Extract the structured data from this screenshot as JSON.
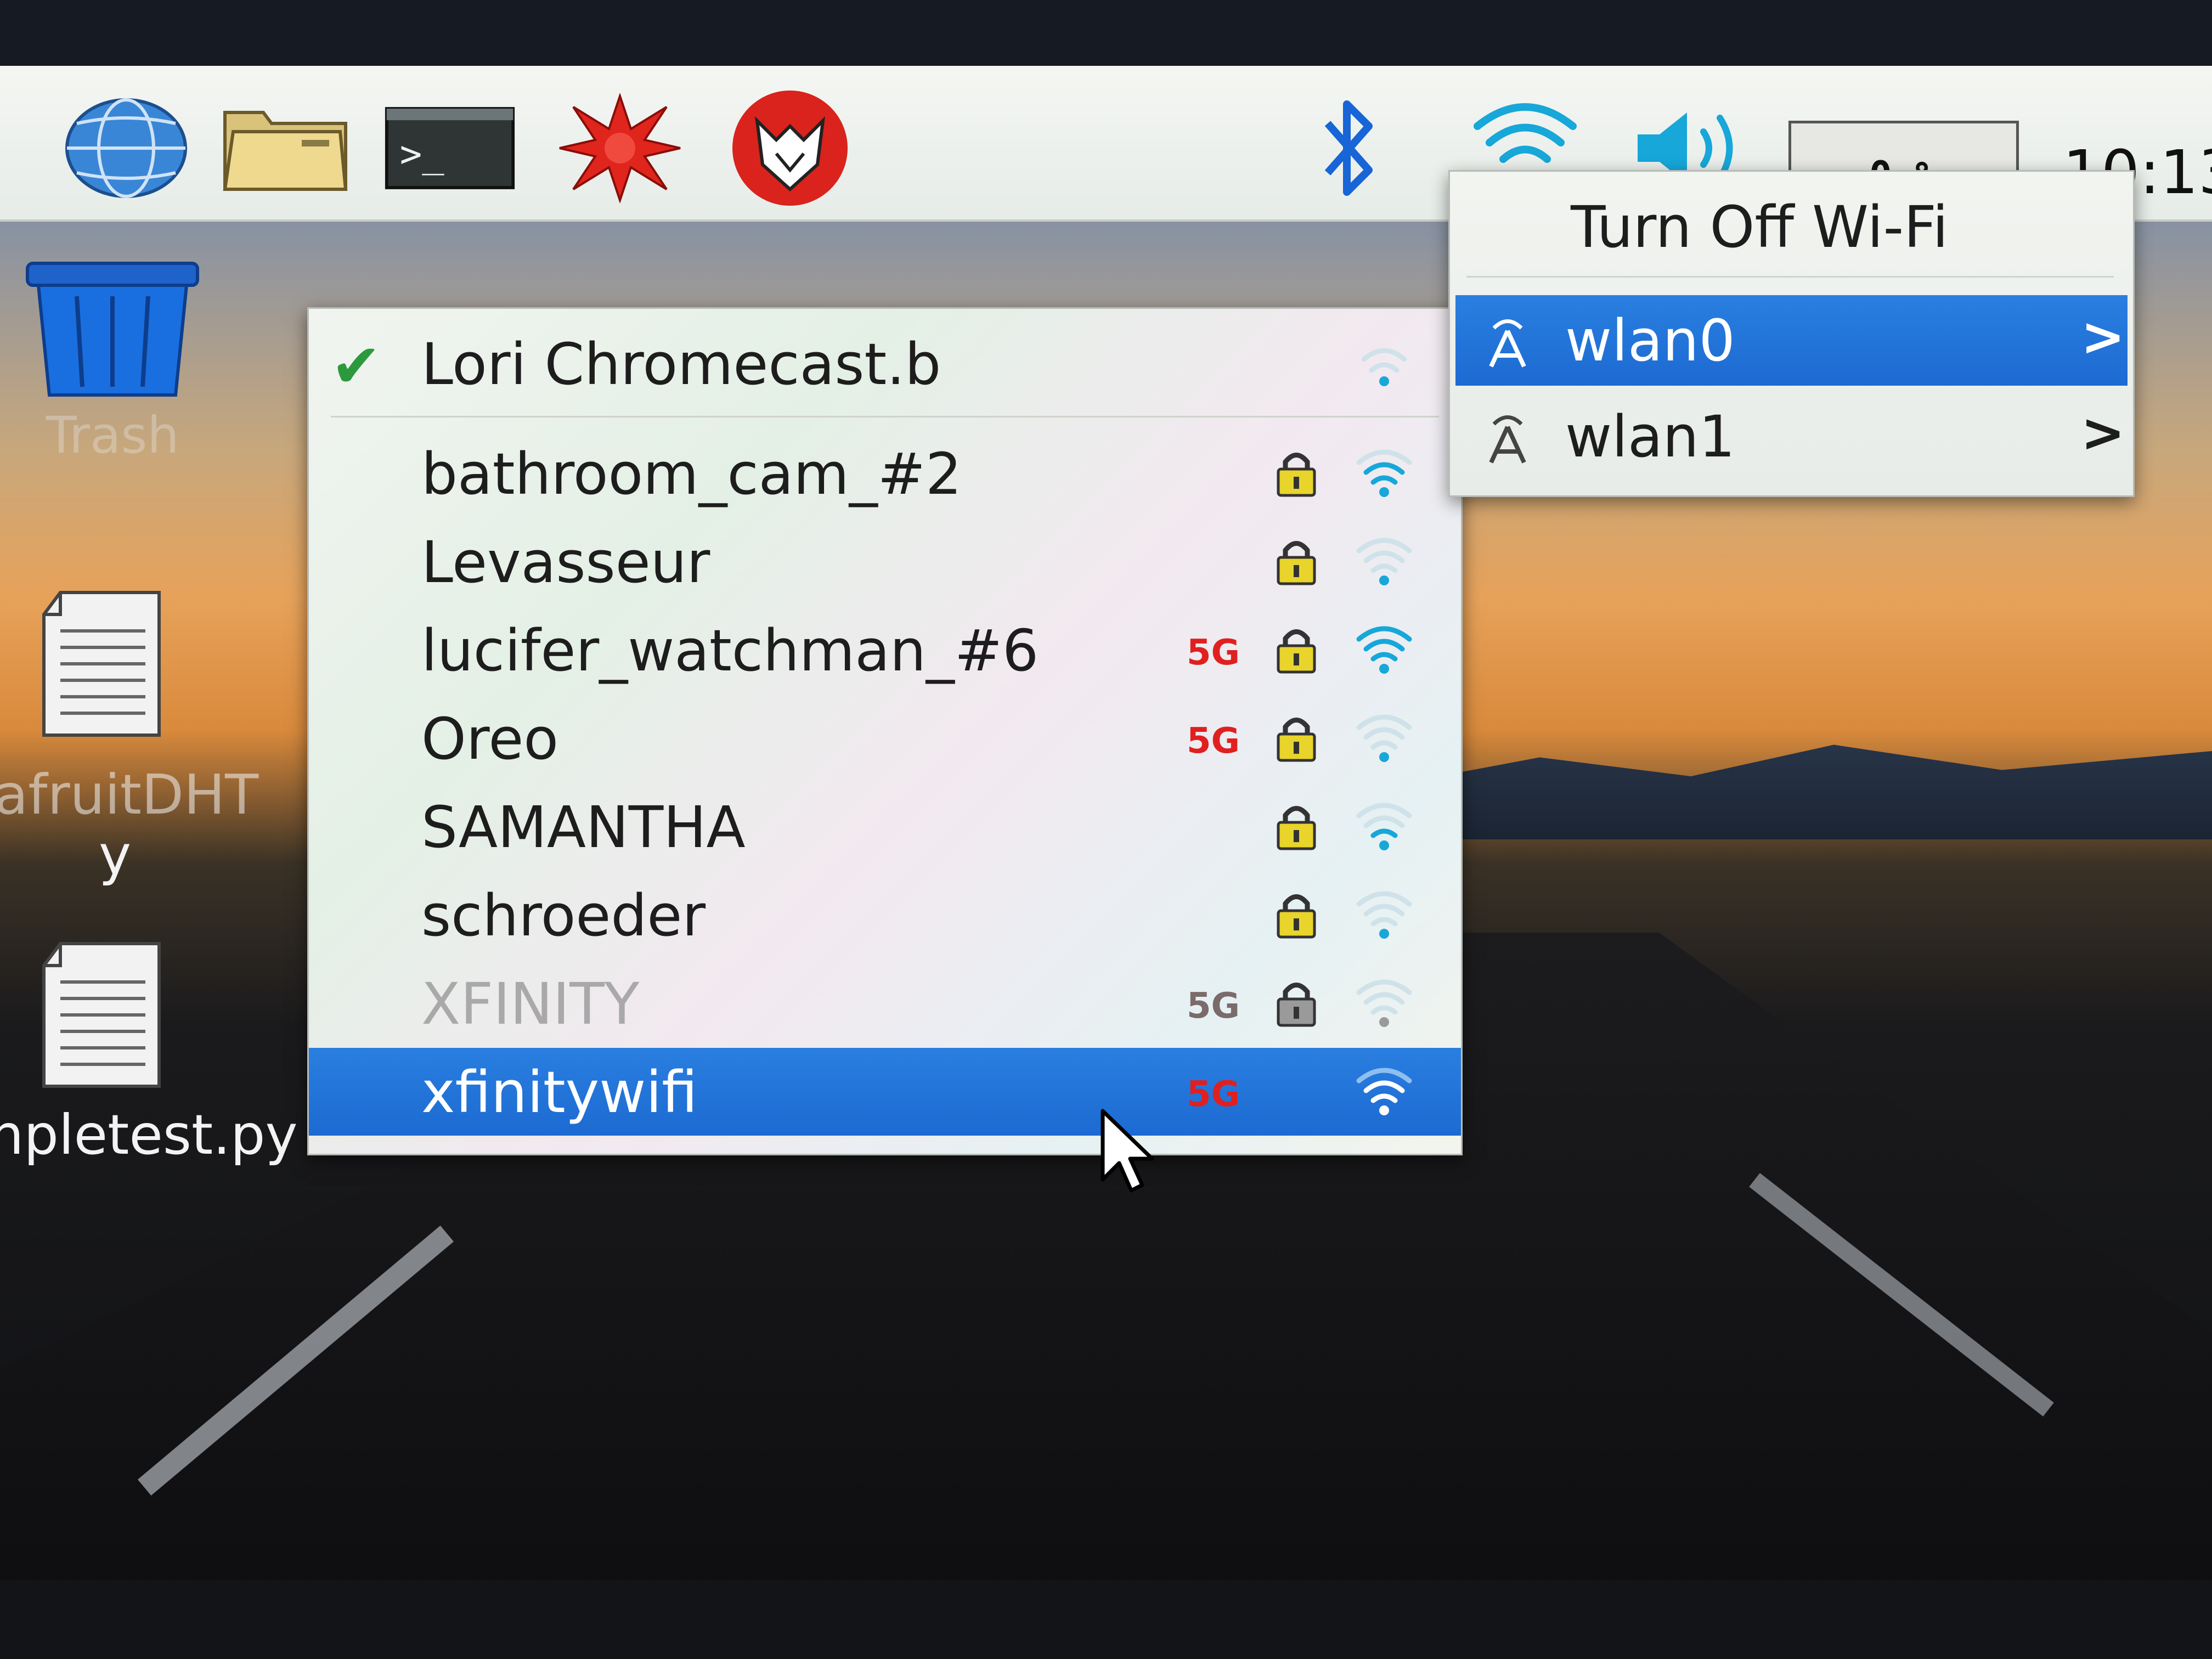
{
  "taskbar": {
    "launchers": [
      {
        "icon": "globe-icon"
      },
      {
        "icon": "folder-icon"
      },
      {
        "icon": "terminal-icon",
        "glyph": ">_"
      },
      {
        "icon": "mathematica-icon"
      },
      {
        "icon": "wolfram-icon"
      }
    ],
    "tray": {
      "bluetooth_icon": "bluetooth-icon",
      "wifi_icon": "wifi-icon",
      "volume_icon": "volume-icon"
    },
    "cpu_usage": "0 %",
    "clock": "10:13"
  },
  "desktop": {
    "trash_label": "Trash",
    "file1_label_a": "afruitDHT",
    "file1_label_b": "y",
    "file2_label": "npletest.py"
  },
  "network_menu": {
    "connected": {
      "ssid": "Lori Chromecast.b",
      "signal": 0.25
    },
    "networks": [
      {
        "ssid": "bathroom_cam_#2",
        "band": "",
        "locked": true,
        "signal": 0.75
      },
      {
        "ssid": "Levasseur",
        "band": "",
        "locked": true,
        "signal": 0.25
      },
      {
        "ssid": "lucifer_watchman_#6",
        "band": "5G",
        "locked": true,
        "signal": 1.0
      },
      {
        "ssid": "Oreo",
        "band": "5G",
        "locked": true,
        "signal": 0.25
      },
      {
        "ssid": "SAMANTHA",
        "band": "",
        "locked": true,
        "signal": 0.5
      },
      {
        "ssid": "schroeder",
        "band": "",
        "locked": true,
        "signal": 0.25
      },
      {
        "ssid": "XFINITY",
        "band": "5G",
        "locked": true,
        "signal": 0.25,
        "disabled": true
      },
      {
        "ssid": "xfinitywifi",
        "band": "5G",
        "locked": false,
        "signal": 0.75,
        "selected": true
      }
    ]
  },
  "wifi_submenu": {
    "title": "Turn Off Wi-Fi",
    "interfaces": [
      {
        "label": "wlan0",
        "arrow": ">",
        "selected": true
      },
      {
        "label": "wlan1",
        "arrow": ">"
      }
    ]
  },
  "colors": {
    "highlight": "#1f72d8",
    "band_5g": "#e02020",
    "check": "#2c9a3c",
    "wifi_signal": "#17a7d9"
  }
}
